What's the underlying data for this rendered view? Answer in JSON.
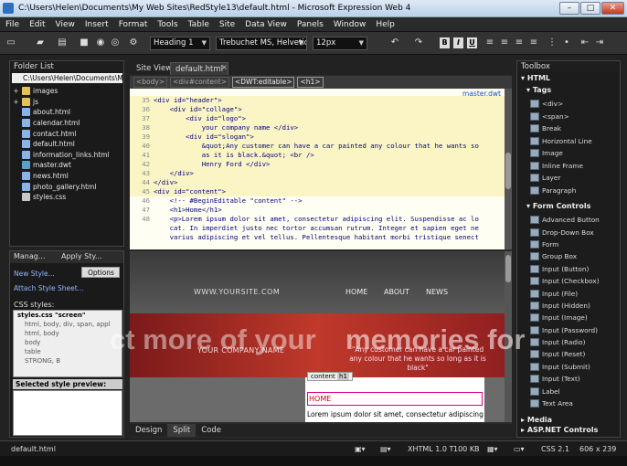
{
  "window": {
    "title": "C:\\Users\\Helen\\Documents\\My Web Sites\\RedStyle13\\default.html - Microsoft Expression Web 4",
    "min_glyph": "–",
    "max_glyph": "□",
    "close_glyph": "✕"
  },
  "menu": [
    "File",
    "Edit",
    "View",
    "Insert",
    "Format",
    "Tools",
    "Table",
    "Site",
    "Data View",
    "Panels",
    "Window",
    "Help"
  ],
  "toolbar": {
    "style_select": "Heading 1",
    "font_select": "Trebuchet MS, Helvetica, ",
    "size_select": "12px",
    "bold": "B",
    "italic": "I",
    "underline": "U"
  },
  "folder_list": {
    "title": "Folder List",
    "path": "C:\\Users\\Helen\\Documents\\My W",
    "files": [
      {
        "name": "images",
        "type": "folder",
        "expandable": true
      },
      {
        "name": "js",
        "type": "folder",
        "expandable": true
      },
      {
        "name": "about.html",
        "type": "html"
      },
      {
        "name": "calendar.html",
        "type": "html"
      },
      {
        "name": "contact.html",
        "type": "html"
      },
      {
        "name": "default.html",
        "type": "html"
      },
      {
        "name": "information_links.html",
        "type": "html"
      },
      {
        "name": "master.dwt",
        "type": "dwt"
      },
      {
        "name": "news.html",
        "type": "html"
      },
      {
        "name": "photo_gallery.html",
        "type": "html"
      },
      {
        "name": "styles.css",
        "type": "css"
      }
    ]
  },
  "styles_panel": {
    "tab_manage": "Manag...",
    "tab_apply": "Apply Sty...",
    "new_style": "New Style...",
    "attach": "Attach Style Sheet...",
    "options": "Options",
    "css_styles": "CSS styles:",
    "rules": [
      {
        "text": "styles.css \"screen\"",
        "head": true
      },
      {
        "text": "html, body, div, span, appl"
      },
      {
        "text": "html, body"
      },
      {
        "text": "body"
      },
      {
        "text": "table"
      },
      {
        "text": "STRONG, B"
      }
    ],
    "selected_preview": "Selected style preview:"
  },
  "editor": {
    "tabs": [
      "Site View",
      "default.html"
    ],
    "active_tab": "default.html",
    "crumbs": [
      "<body>",
      "<div#content>",
      "<DWT:editable>",
      "<h1>"
    ],
    "master_link": "master.dwt",
    "code_lines": [
      {
        "n": "35",
        "text": "<div id=\"header\">",
        "hl": true
      },
      {
        "n": "36",
        "text": "    <div id=\"collage\">",
        "hl": true
      },
      {
        "n": "37",
        "text": "        <div id=\"logo\">",
        "hl": true
      },
      {
        "n": "38",
        "text": "            your company name </div>",
        "hl": true
      },
      {
        "n": "39",
        "text": "        <div id=\"slogan\">",
        "hl": true
      },
      {
        "n": "40",
        "text": "            &quot;Any customer can have a car painted any colour that he wants so",
        "hl": true
      },
      {
        "n": "41",
        "text": "            as it is black.&quot; <br />",
        "hl": true
      },
      {
        "n": "42",
        "text": "            Henry Ford </div>",
        "hl": true
      },
      {
        "n": "43",
        "text": "    </div>",
        "hl": true
      },
      {
        "n": "44",
        "text": "</div>",
        "hl": true
      },
      {
        "n": "45",
        "text": "<div id=\"content\">",
        "hl": true
      },
      {
        "n": "46",
        "text": "    <!-- #BeginEditable \"content\" -->",
        "hl": false
      },
      {
        "n": "47",
        "text": "    <h1>Home</h1>",
        "hl": false
      },
      {
        "n": "48",
        "text": "    <p>Lorem ipsum dolor sit amet, consectetur adipiscing elit. Suspendisse ac lo",
        "hl": false
      },
      {
        "n": "",
        "text": "    cat. In imperdiet justo nec tortor accumsan rutrum. Integer et sapien eget ne",
        "hl": false
      },
      {
        "n": "",
        "text": "    varius adipiscing et vel tellus. Pellentesque habitant morbi tristique senect",
        "hl": false
      }
    ],
    "design": {
      "url": "WWW.YOURSITE.COM",
      "nav": [
        "HOME",
        "ABOUT",
        "NEWS"
      ],
      "company": "YOUR COMPANY NAME",
      "quote": "\"Any customer can have a car painted any colour that he wants so long as it is black\"",
      "content_tag": "content",
      "h1_tag": "h1",
      "home": "HOME",
      "lorem": "Lorem ipsum dolor sit amet, consectetur adipiscing"
    },
    "view_tabs": [
      "Design",
      "Split",
      "Code"
    ],
    "active_view": "Split"
  },
  "toolbox": {
    "title": "Toolbox",
    "html_section": "HTML",
    "tags_section": "Tags",
    "tags": [
      "<div>",
      "<span>",
      "Break",
      "Horizontal Line",
      "Image",
      "Inline Frame",
      "Layer",
      "Paragraph"
    ],
    "form_section": "Form Controls",
    "forms": [
      "Advanced Button",
      "Drop-Down Box",
      "Form",
      "Group Box",
      "Input (Button)",
      "Input (Checkbox)",
      "Input (File)",
      "Input (Hidden)",
      "Input (Image)",
      "Input (Password)",
      "Input (Radio)",
      "Input (Reset)",
      "Input (Submit)",
      "Input (Text)",
      "Label",
      "Text Area"
    ],
    "media_section": "Media",
    "aspnet_section": "ASP.NET Controls"
  },
  "status": {
    "file": "default.html",
    "doctype": "XHTML 1.0 T",
    "size": "100 KB",
    "css": "CSS 2.1",
    "dims": "606 x 239"
  },
  "watermark": {
    "line_a": "ct more of your",
    "line_b": "memories for"
  }
}
